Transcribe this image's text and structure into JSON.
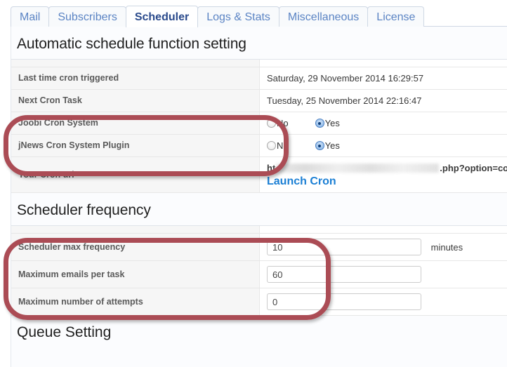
{
  "tabs": [
    {
      "label": "Mail",
      "active": false
    },
    {
      "label": "Subscribers",
      "active": false
    },
    {
      "label": "Scheduler",
      "active": true
    },
    {
      "label": "Logs & Stats",
      "active": false
    },
    {
      "label": "Miscellaneous",
      "active": false
    },
    {
      "label": "License",
      "active": false
    }
  ],
  "sections": {
    "automatic": {
      "title": "Automatic schedule function setting",
      "rows": {
        "last_cron_label": "Last time cron triggered",
        "last_cron_value": "Saturday, 29 November 2014 16:29:57",
        "next_cron_label": "Next Cron Task",
        "next_cron_value": "Tuesday, 25 November 2014 22:16:47",
        "joobi_label": "Joobi Cron System",
        "joobi_no": "No",
        "joobi_yes": "Yes",
        "joobi_selected": "Yes",
        "jnews_label": "jNews Cron System Plugin",
        "jnews_no": "No",
        "jnews_yes": "Yes",
        "jnews_selected": "Yes",
        "cron_url_label": "Your Cron url",
        "cron_url_prefix": "ht",
        "cron_url_suffix": ".php?option=com_jnews&act=cron&tmpl=component",
        "launch_cron": "Launch Cron"
      }
    },
    "frequency": {
      "title": "Scheduler frequency",
      "rows": {
        "max_frequency_label": "Scheduler max frequency",
        "max_frequency_value": "10",
        "max_frequency_unit": "minutes",
        "max_emails_label": "Maximum emails per task",
        "max_emails_value": "60",
        "max_attempts_label": "Maximum number of attempts",
        "max_attempts_value": "0"
      }
    },
    "queue": {
      "title": "Queue Setting"
    }
  },
  "annotations": {
    "color": "#ab4c55",
    "items": [
      {
        "name": "cron-system-highlight"
      },
      {
        "name": "scheduler-frequency-highlight"
      }
    ]
  },
  "colors": {
    "tab_link": "#5b84c4",
    "tab_active": "#2a4a8c",
    "launch_link": "#1b7fd4",
    "label_bg": "#f6f6f6",
    "annotation_red": "#ab4c55"
  }
}
